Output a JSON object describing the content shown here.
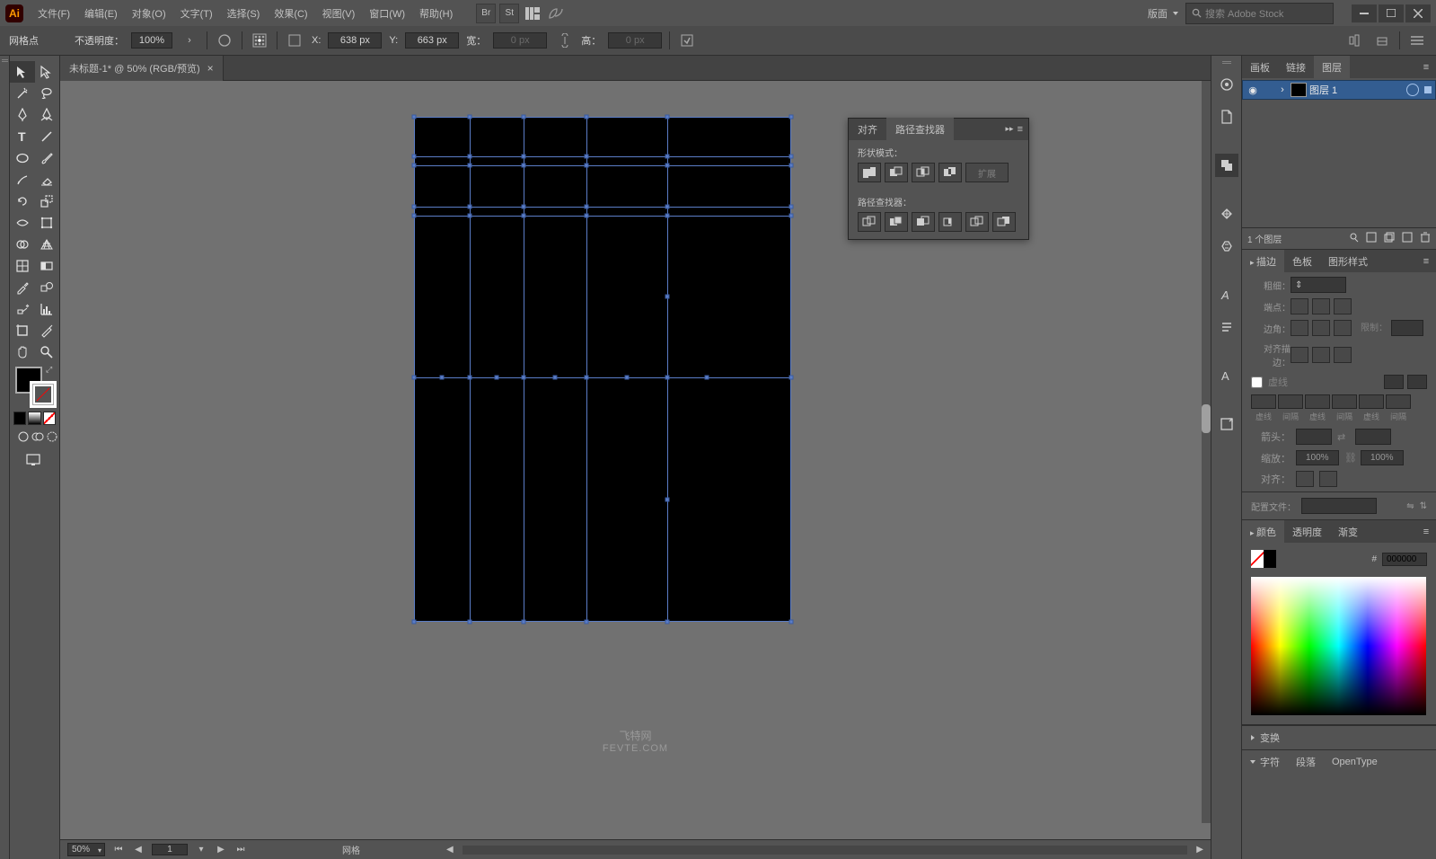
{
  "menu": [
    "文件(F)",
    "编辑(E)",
    "对象(O)",
    "文字(T)",
    "选择(S)",
    "效果(C)",
    "视图(V)",
    "窗口(W)",
    "帮助(H)"
  ],
  "workspace_label": "版面",
  "search_placeholder": "搜索 Adobe Stock",
  "control": {
    "sel_type": "网格点",
    "opacity_label": "不透明度：",
    "opacity_val": "100%",
    "x_label": "X:",
    "x_val": "638 px",
    "y_label": "Y:",
    "y_val": "663 px",
    "w_label": "宽：",
    "w_val": "0 px",
    "h_label": "高：",
    "h_val": "0 px"
  },
  "tab_title": "未标题-1* @ 50% (RGB/预览)",
  "status": {
    "zoom": "50%",
    "page": "1",
    "mode": "网格"
  },
  "watermark": {
    "l1": "飞特网",
    "l2": "FEVTE.COM"
  },
  "float": {
    "tab_align": "对齐",
    "tab_pf": "路径查找器",
    "shape_mode": "形状模式：",
    "expand": "扩展",
    "pf_label": "路径查找器："
  },
  "layers": {
    "tab_artboard": "画板",
    "tab_links": "链接",
    "tab_layers": "图层",
    "layer1": "图层 1",
    "count": "1 个图层"
  },
  "stroke": {
    "tab_stroke": "描边",
    "tab_swatch": "色板",
    "tab_gstyle": "图形样式",
    "weight": "粗细：",
    "cap": "端点：",
    "corner": "边角：",
    "limit": "限制：",
    "align": "对齐描边：",
    "dashed": "虚线",
    "d1": "虚线",
    "d2": "间隔",
    "d3": "虚线",
    "d4": "间隔",
    "d5": "虚线",
    "d6": "间隔",
    "arrow": "箭头：",
    "scale": "缩放：",
    "scale_val": "100%",
    "arralign": "对齐：",
    "profile": "配置文件："
  },
  "color": {
    "tab_color": "颜色",
    "tab_opacity": "透明度",
    "tab_grad": "渐变",
    "hex_prefix": "#",
    "hex": "000000"
  },
  "accordion": {
    "transform": "变换",
    "char": "字符",
    "para": "段落",
    "ot": "OpenType"
  }
}
